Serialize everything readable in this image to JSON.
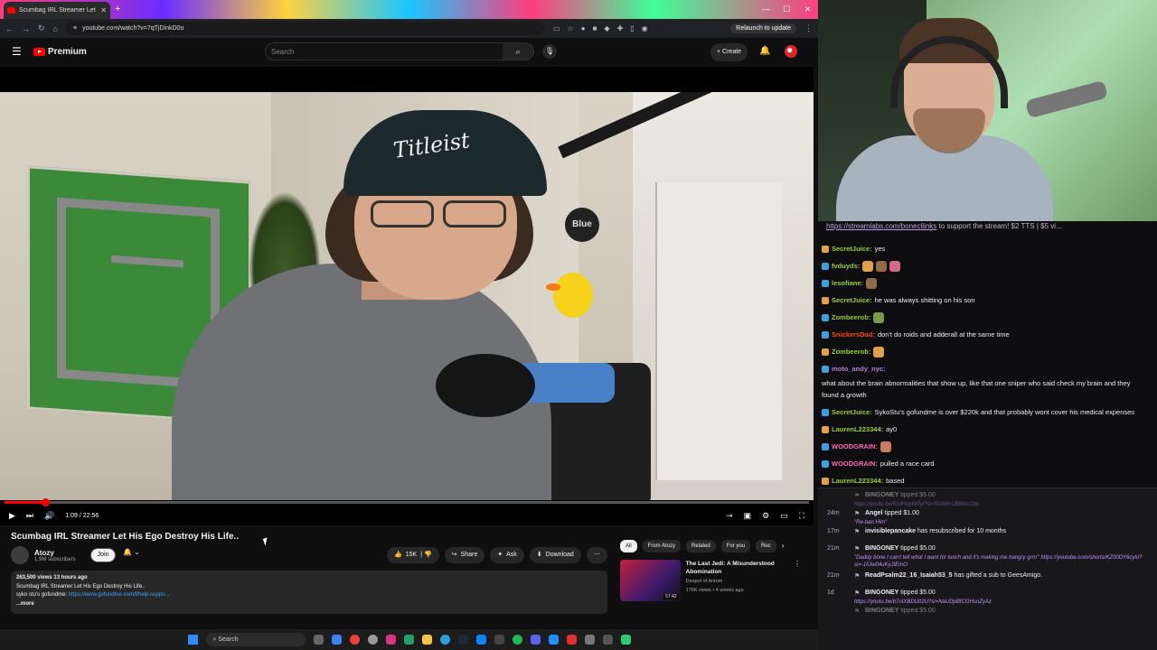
{
  "browser": {
    "tab_title": "Scumbag IRL Streamer Let His",
    "url": "youtube.com/watch?v=7qTjDinkD0o",
    "relaunch_label": "Relaunch to update"
  },
  "youtube": {
    "logo_text": "Premium",
    "search_placeholder": "Search",
    "create_label": "Create",
    "video": {
      "brand_on_cap": "Titleist",
      "mic_ball_text": "Blue",
      "time": "1:09 / 22:56",
      "progress_fraction": 0.05,
      "title": "Scumbag IRL Streamer Let His Ego Destroy His Life..",
      "channel": "Atozy",
      "subscribers": "1.9M subscribers",
      "join_label": "Join",
      "likes": "15K",
      "share_label": "Share",
      "ask_label": "Ask",
      "download_label": "Download",
      "description": {
        "stats": "263,500 views  13 hours ago",
        "line1": "Scumbag IRL Streamer Let His Ego Destroy His Life..",
        "line2_prefix": "syko stu's gofundme: ",
        "line2_link": "https://www.gofundme.com/f/help-suppo...",
        "more": "...more"
      }
    },
    "chips": [
      "All",
      "From Atozy",
      "Related",
      "For you",
      "Rec"
    ],
    "recommendation": {
      "title": "The Last Jedi: A Misunderstood Abomination",
      "channel": "Despot of Antrim",
      "meta": "176K views • 4 weeks ago",
      "duration": "57:42"
    }
  },
  "taskbar": {
    "search_label": "Search"
  },
  "chat": {
    "banner_link": "https://streamlabs.com/bonecliinks",
    "banner_text": " to support the stream! $2 TTS | $5 vi...",
    "messages": [
      {
        "user": "SecretJuice",
        "color": "#9acd32",
        "text": "yes"
      },
      {
        "user": "fvduyds",
        "color": "#9acd32",
        "text": ""
      },
      {
        "user": "lesofiane",
        "color": "#9acd32",
        "text": ""
      },
      {
        "user": "SecretJuice",
        "color": "#9acd32",
        "text": "he was always shitting on his son"
      },
      {
        "user": "Zombeerob",
        "color": "#9acd32",
        "text": ""
      },
      {
        "user": "SnickersDad",
        "color": "#ff4500",
        "text": "don't do roids and adderall at the same time"
      },
      {
        "user": "Zombeerob",
        "color": "#9acd32",
        "text": ""
      },
      {
        "user": "moto_andy_nyc",
        "color": "#b57edc",
        "text": "what about the brain abnormalities that show up, like that one sniper who said check my brain and they found a growth"
      },
      {
        "user": "SecretJuice",
        "color": "#9acd32",
        "text": "SykoStu's gofundme is over $220k and that probably wont cover his medical expenses"
      },
      {
        "user": "LaurenL223344",
        "color": "#9acd32",
        "text": "ay0"
      },
      {
        "user": "WOODGRAIN",
        "color": "#ff69b4",
        "text": ""
      },
      {
        "user": "WOODGRAIN",
        "color": "#ff69b4",
        "text": "pulled a race card"
      },
      {
        "user": "LaurenL223344",
        "color": "#9acd32",
        "text": "based"
      }
    ],
    "events": [
      {
        "time": "",
        "who": "BINGONEY",
        "text": " tipped $5.00",
        "sub": "https://youtu.be/51dHvpWPyl?si=fXbMm1BB4Xr1bn",
        "dim": true
      },
      {
        "time": "24m",
        "who": "Angel",
        "text": " tipped $1.00",
        "sub": "\"Re-ban Him\"",
        "dim": false
      },
      {
        "time": "17m",
        "who": "invisiblepancake",
        "text": " has resubscribed for 10 months",
        "sub": "",
        "dim": false
      },
      {
        "time": "21m",
        "who": "BINGONEY",
        "text": " tipped $5.00",
        "sub": "\"Daddy bone I can't tell what I want for lunch and it's making me hangry grrrr\" https://youtube.com/shorts/KZ00DY6cylo?si=-1fiJw04uKyJIEmO",
        "dim": false
      },
      {
        "time": "21m",
        "who": "ReadPsalm22_16_Isaiah53_5",
        "text": " has gifted a sub to GeesAmigo.",
        "sub": "",
        "dim": false
      },
      {
        "time": "1d",
        "who": "BINGONEY",
        "text": " tipped $5.00",
        "sub": "https://youtu.be/b7oIXBDU02U?si=NaUDpBfCGHsnZyAz",
        "dim": false
      },
      {
        "time": "",
        "who": "BINGONEY",
        "text": " tipped $5.00",
        "sub": "",
        "dim": true
      }
    ]
  }
}
